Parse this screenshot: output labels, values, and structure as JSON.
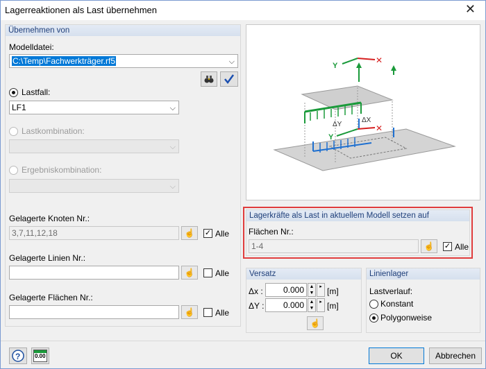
{
  "window": {
    "title": "Lagerreaktionen als Last übernehmen"
  },
  "left": {
    "group_title": "Übernehmen von",
    "modelfile_label": "Modelldatei:",
    "modelfile_value": "C:\\Temp\\Fachwerkträger.rf5",
    "lastfall_label": "Lastfall:",
    "lastfall_value": "LF1",
    "lastkombination_label": "Lastkombination:",
    "ergebniskombination_label": "Ergebniskombination:",
    "knoten_label": "Gelagerte Knoten Nr.:",
    "knoten_value": "3,7,11,12,18",
    "linien_label": "Gelagerte Linien Nr.:",
    "flaechen_label": "Gelagerte Flächen Nr.:",
    "alle": "Alle"
  },
  "right": {
    "set_group_title": "Lagerkräfte als Last in aktuellem Modell setzen auf",
    "flaechen_label": "Flächen Nr.:",
    "flaechen_value": "1-4",
    "alle": "Alle",
    "versatz_title": "Versatz",
    "dx_label": "Δx :",
    "dx_value": "0.000",
    "dy_label": "ΔY :",
    "dy_value": "0.000",
    "unit": "[m]",
    "linienlager_title": "Linienlager",
    "lastverlauf_label": "Lastverlauf:",
    "konstant": "Konstant",
    "polygonweise": "Polygonweise"
  },
  "diagram": {
    "dy": "ΔY",
    "dx": "ΔX",
    "y": "Y",
    "x": "X"
  },
  "footer": {
    "ok": "OK",
    "cancel": "Abbrechen",
    "calc_icon_text": "0.00"
  },
  "colors": {
    "accent": "#0078d7",
    "highlight": "#e03c3c",
    "green": "#1a9a3a",
    "red": "#d62020",
    "blue": "#1d6fd0"
  }
}
